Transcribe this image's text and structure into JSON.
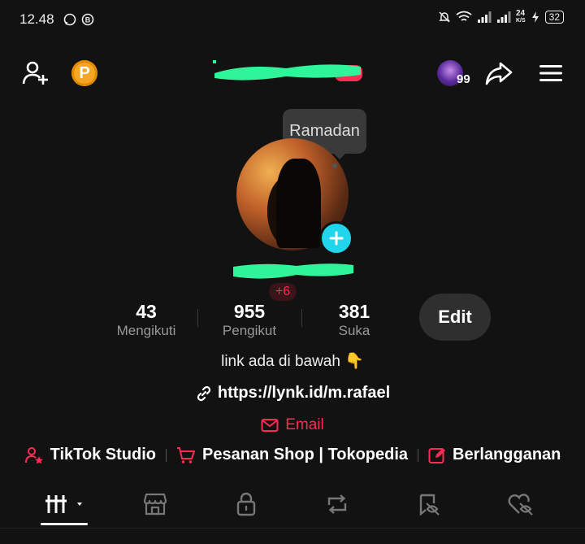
{
  "status_bar": {
    "time": "12.48",
    "network_speed_value": "24",
    "network_speed_unit": "K/S",
    "battery": "32"
  },
  "profile": {
    "tooltip": "Ramadan",
    "badge": "+6",
    "stats": [
      {
        "value": "43",
        "label": "Mengikuti"
      },
      {
        "value": "955",
        "label": "Pengikut"
      },
      {
        "value": "381",
        "label": "Suka"
      }
    ],
    "edit_label": "Edit",
    "friends_count": "99",
    "bio": "link ada di bawah 👇",
    "link": "https://lynk.id/m.rafael",
    "email_label": "Email"
  },
  "tools": [
    {
      "label": "TikTok Studio"
    },
    {
      "label": "Pesanan Shop | Tokopedia"
    },
    {
      "label": "Berlangganan"
    }
  ],
  "colors": {
    "accent": "#fe2c55",
    "add_button": "#20d5ec",
    "redaction": "#2ef59a",
    "background": "#121212"
  }
}
